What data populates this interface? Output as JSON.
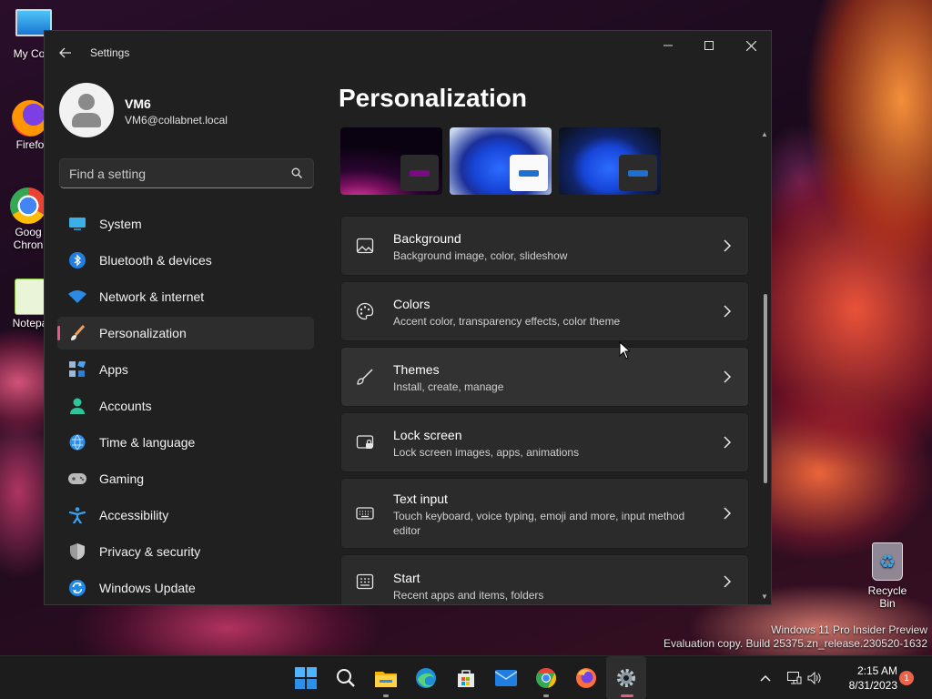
{
  "desktop": {
    "icons": [
      {
        "label": "My Com",
        "icon": "computer-icon"
      },
      {
        "label": "Firefo",
        "icon": "firefox-icon"
      },
      {
        "label": "Goog Chron",
        "icon": "chrome-icon"
      },
      {
        "label": "Notepa",
        "icon": "notepad-icon"
      }
    ],
    "recycle_bin": "Recycle Bin",
    "watermark_line1": "Windows 11 Pro Insider Preview",
    "watermark_line2": "Evaluation copy. Build 25375.zn_release.230520-1632"
  },
  "window": {
    "title": "Settings",
    "user": {
      "name": "VM6",
      "email": "VM6@collabnet.local"
    },
    "search": {
      "placeholder": "Find a setting"
    },
    "nav": [
      {
        "label": "System",
        "icon": "system-icon",
        "active": false
      },
      {
        "label": "Bluetooth & devices",
        "icon": "bluetooth-icon",
        "active": false
      },
      {
        "label": "Network & internet",
        "icon": "wifi-icon",
        "active": false
      },
      {
        "label": "Personalization",
        "icon": "brush-icon",
        "active": true
      },
      {
        "label": "Apps",
        "icon": "apps-icon",
        "active": false
      },
      {
        "label": "Accounts",
        "icon": "accounts-icon",
        "active": false
      },
      {
        "label": "Time & language",
        "icon": "globe-icon",
        "active": false
      },
      {
        "label": "Gaming",
        "icon": "gamepad-icon",
        "active": false
      },
      {
        "label": "Accessibility",
        "icon": "accessibility-icon",
        "active": false
      },
      {
        "label": "Privacy & security",
        "icon": "shield-icon",
        "active": false
      },
      {
        "label": "Windows Update",
        "icon": "update-icon",
        "active": false
      }
    ],
    "page_title": "Personalization",
    "themes": [
      {
        "name": "theme-dark-purple"
      },
      {
        "name": "theme-light-bloom"
      },
      {
        "name": "theme-dark-bloom"
      }
    ],
    "cards": [
      {
        "title": "Background",
        "subtitle": "Background image, color, slideshow",
        "icon": "image-icon"
      },
      {
        "title": "Colors",
        "subtitle": "Accent color, transparency effects, color theme",
        "icon": "palette-icon"
      },
      {
        "title": "Themes",
        "subtitle": "Install, create, manage",
        "icon": "brush-icon"
      },
      {
        "title": "Lock screen",
        "subtitle": "Lock screen images, apps, animations",
        "icon": "lock-screen-icon"
      },
      {
        "title": "Text input",
        "subtitle": "Touch keyboard, voice typing, emoji and more, input method editor",
        "icon": "keyboard-icon"
      },
      {
        "title": "Start",
        "subtitle": "Recent apps and items, folders",
        "icon": "start-icon"
      }
    ]
  },
  "taskbar": {
    "apps": [
      "start-icon",
      "search-icon",
      "file-explorer-icon",
      "edge-icon",
      "store-icon",
      "mail-icon",
      "chrome-icon",
      "firefox-icon",
      "settings-icon"
    ],
    "time": "2:15 AM",
    "date": "8/31/2023",
    "notifications": "1"
  },
  "colors": {
    "accent": "#e85a86",
    "window_bg": "#202020",
    "card_bg": "#2b2b2b"
  }
}
